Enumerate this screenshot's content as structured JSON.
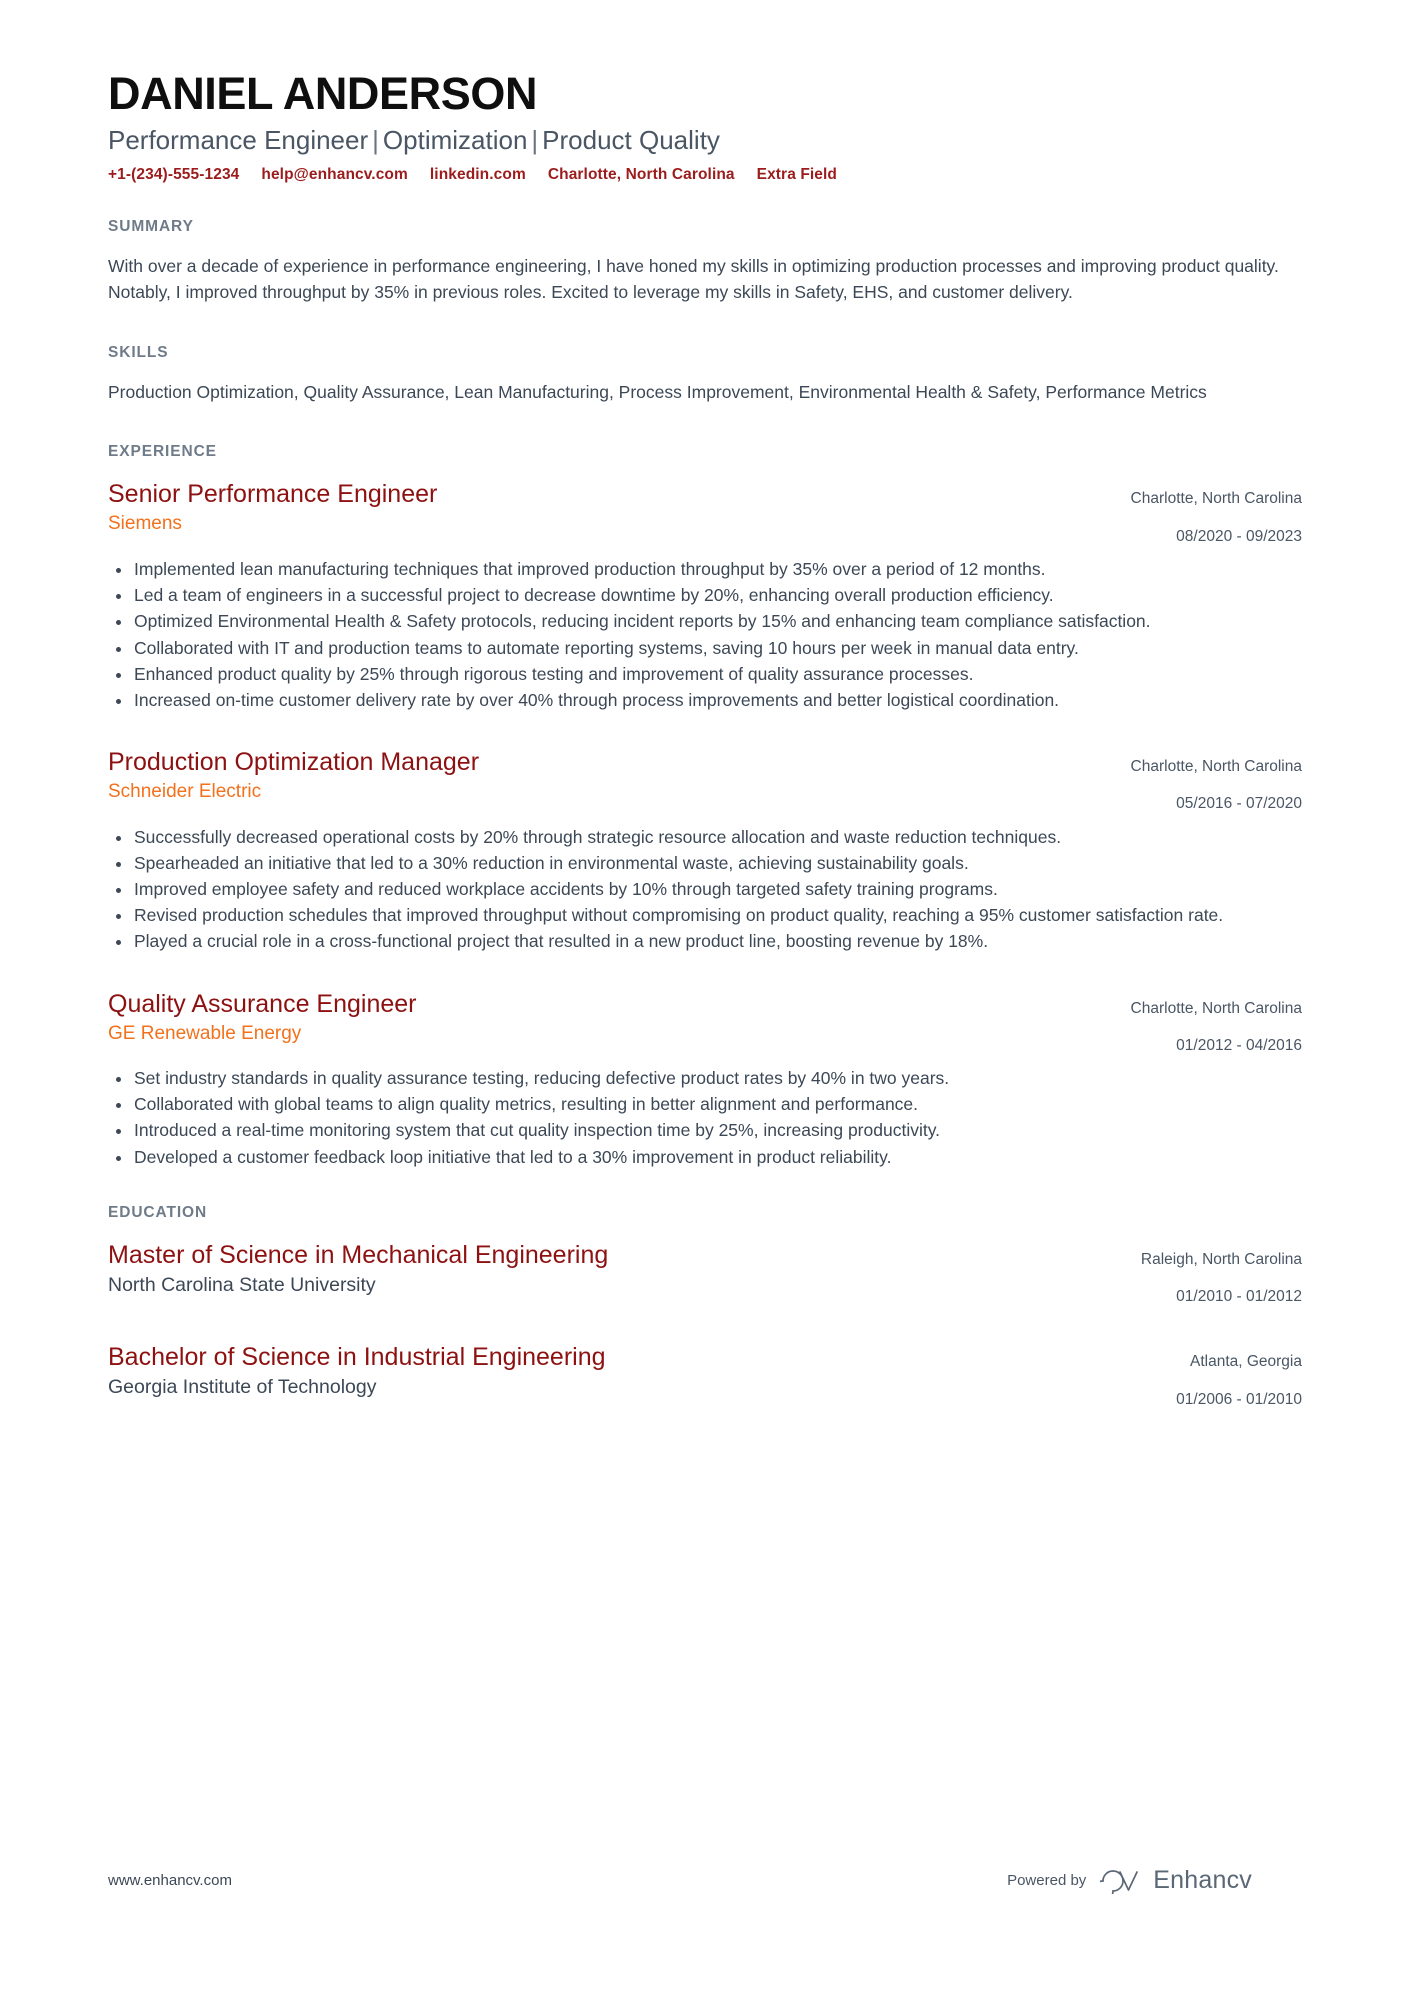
{
  "header": {
    "name": "DANIEL ANDERSON",
    "headline_parts": [
      "Performance Engineer",
      "Optimization",
      "Product Quality"
    ],
    "headline_separator": "|",
    "contacts": [
      {
        "name": "phone",
        "value": "+1-(234)-555-1234"
      },
      {
        "name": "email",
        "value": "help@enhancv.com"
      },
      {
        "name": "linkedin",
        "value": "linkedin.com"
      },
      {
        "name": "location",
        "value": "Charlotte, North Carolina"
      },
      {
        "name": "extra-field",
        "value": "Extra Field"
      }
    ]
  },
  "summary": {
    "title": "SUMMARY",
    "text": "With over a decade of experience in performance engineering, I have honed my skills in optimizing production processes and improving product quality. Notably, I improved throughput by 35% in previous roles. Excited to leverage my skills in Safety, EHS, and customer delivery."
  },
  "skills": {
    "title": "SKILLS",
    "text": "Production Optimization, Quality Assurance, Lean Manufacturing, Process Improvement, Environmental Health & Safety, Performance Metrics"
  },
  "experience": {
    "title": "EXPERIENCE",
    "entries": [
      {
        "role": "Senior Performance Engineer",
        "company": "Siemens",
        "location": "Charlotte, North Carolina",
        "dates": "08/2020 - 09/2023",
        "bullets": [
          "Implemented lean manufacturing techniques that improved production throughput by 35% over a period of 12 months.",
          "Led a team of engineers in a successful project to decrease downtime by 20%, enhancing overall production efficiency.",
          "Optimized Environmental Health & Safety protocols, reducing incident reports by 15% and enhancing team compliance satisfaction.",
          "Collaborated with IT and production teams to automate reporting systems, saving 10 hours per week in manual data entry.",
          "Enhanced product quality by 25% through rigorous testing and improvement of quality assurance processes.",
          "Increased on-time customer delivery rate by over 40% through process improvements and better logistical coordination."
        ]
      },
      {
        "role": "Production Optimization Manager",
        "company": "Schneider Electric",
        "location": "Charlotte, North Carolina",
        "dates": "05/2016 - 07/2020",
        "bullets": [
          "Successfully decreased operational costs by 20% through strategic resource allocation and waste reduction techniques.",
          "Spearheaded an initiative that led to a 30% reduction in environmental waste, achieving sustainability goals.",
          "Improved employee safety and reduced workplace accidents by 10% through targeted safety training programs.",
          "Revised production schedules that improved throughput without compromising on product quality, reaching a 95% customer satisfaction rate.",
          "Played a crucial role in a cross-functional project that resulted in a new product line, boosting revenue by 18%."
        ]
      },
      {
        "role": "Quality Assurance Engineer",
        "company": "GE Renewable Energy",
        "location": "Charlotte, North Carolina",
        "dates": "01/2012 - 04/2016",
        "bullets": [
          "Set industry standards in quality assurance testing, reducing defective product rates by 40% in two years.",
          "Collaborated with global teams to align quality metrics, resulting in better alignment and performance.",
          "Introduced a real-time monitoring system that cut quality inspection time by 25%, increasing productivity.",
          "Developed a customer feedback loop initiative that led to a 30% improvement in product reliability."
        ]
      }
    ]
  },
  "education": {
    "title": "EDUCATION",
    "entries": [
      {
        "degree": "Master of Science in Mechanical Engineering",
        "institution": "North Carolina State University",
        "location": "Raleigh, North Carolina",
        "dates": "01/2010 - 01/2012"
      },
      {
        "degree": "Bachelor of Science in Industrial Engineering",
        "institution": "Georgia Institute of Technology",
        "location": "Atlanta, Georgia",
        "dates": "01/2006 - 01/2010"
      }
    ]
  },
  "footer": {
    "url": "www.enhancv.com",
    "powered_by": "Powered by",
    "brand": "Enhancv"
  },
  "colors": {
    "accent_red": "#8d1111",
    "contact_red": "#9b1c1c",
    "accent_orange": "#f2711c",
    "section_label": "#6f7b89",
    "body": "#3c4856"
  }
}
